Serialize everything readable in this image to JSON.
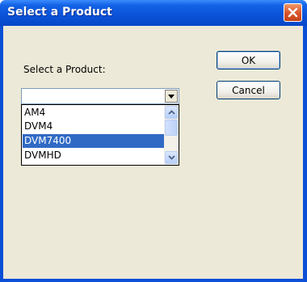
{
  "window": {
    "title": "Select a Product"
  },
  "form": {
    "label": "Select a Product:",
    "combo_value": "",
    "ok_label": "OK",
    "cancel_label": "Cancel"
  },
  "dropdown": {
    "items": [
      "AM4",
      "DVM4",
      "DVM7400",
      "DVMHD"
    ],
    "selected": "DVM7400"
  },
  "icons": {
    "close": "close-icon",
    "combo_arrow": "chevron-down-icon",
    "scroll_up": "scroll-up-icon",
    "scroll_down": "scroll-down-icon"
  },
  "colors": {
    "titlebar": "#0a52d8",
    "close_button": "#d9522a",
    "selection": "#316ac5",
    "dialog_face": "#ece9d8"
  }
}
